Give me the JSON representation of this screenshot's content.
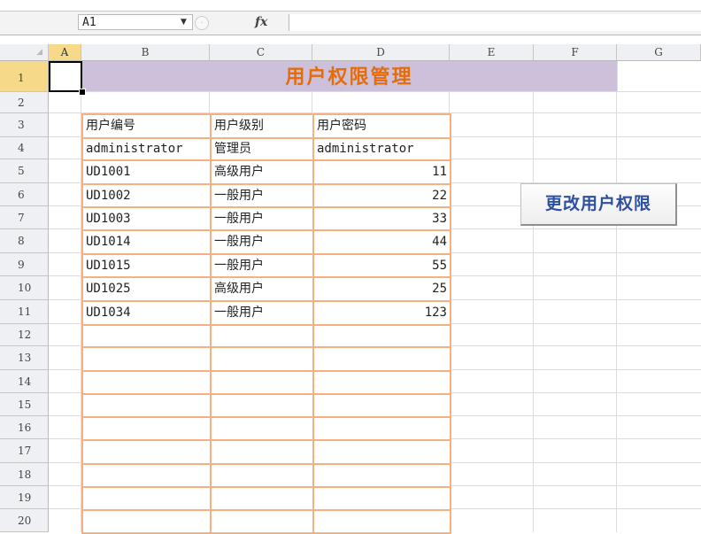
{
  "formula_bar": {
    "name_box": "A1",
    "fx_label": "fx",
    "formula": ""
  },
  "columns": [
    "A",
    "B",
    "C",
    "D",
    "E",
    "F",
    "G"
  ],
  "rows": [
    "1",
    "2",
    "3",
    "4",
    "5",
    "6",
    "7",
    "8",
    "9",
    "10",
    "11",
    "12",
    "13",
    "14",
    "15",
    "16",
    "17",
    "18",
    "19",
    "20"
  ],
  "title": "用户权限管理",
  "table": {
    "headers": [
      "用户编号",
      "用户级别",
      "用户密码"
    ],
    "rows": [
      [
        "administrator",
        "管理员",
        "administrator"
      ],
      [
        "UD1001",
        "高级用户",
        "11"
      ],
      [
        "UD1002",
        "一般用户",
        "22"
      ],
      [
        "UD1003",
        "一般用户",
        "33"
      ],
      [
        "UD1014",
        "一般用户",
        "44"
      ],
      [
        "UD1015",
        "一般用户",
        "55"
      ],
      [
        "UD1025",
        "高级用户",
        "25"
      ],
      [
        "UD1034",
        "一般用户",
        "123"
      ]
    ],
    "empty_rows": 9
  },
  "button": {
    "label": "更改用户权限"
  }
}
